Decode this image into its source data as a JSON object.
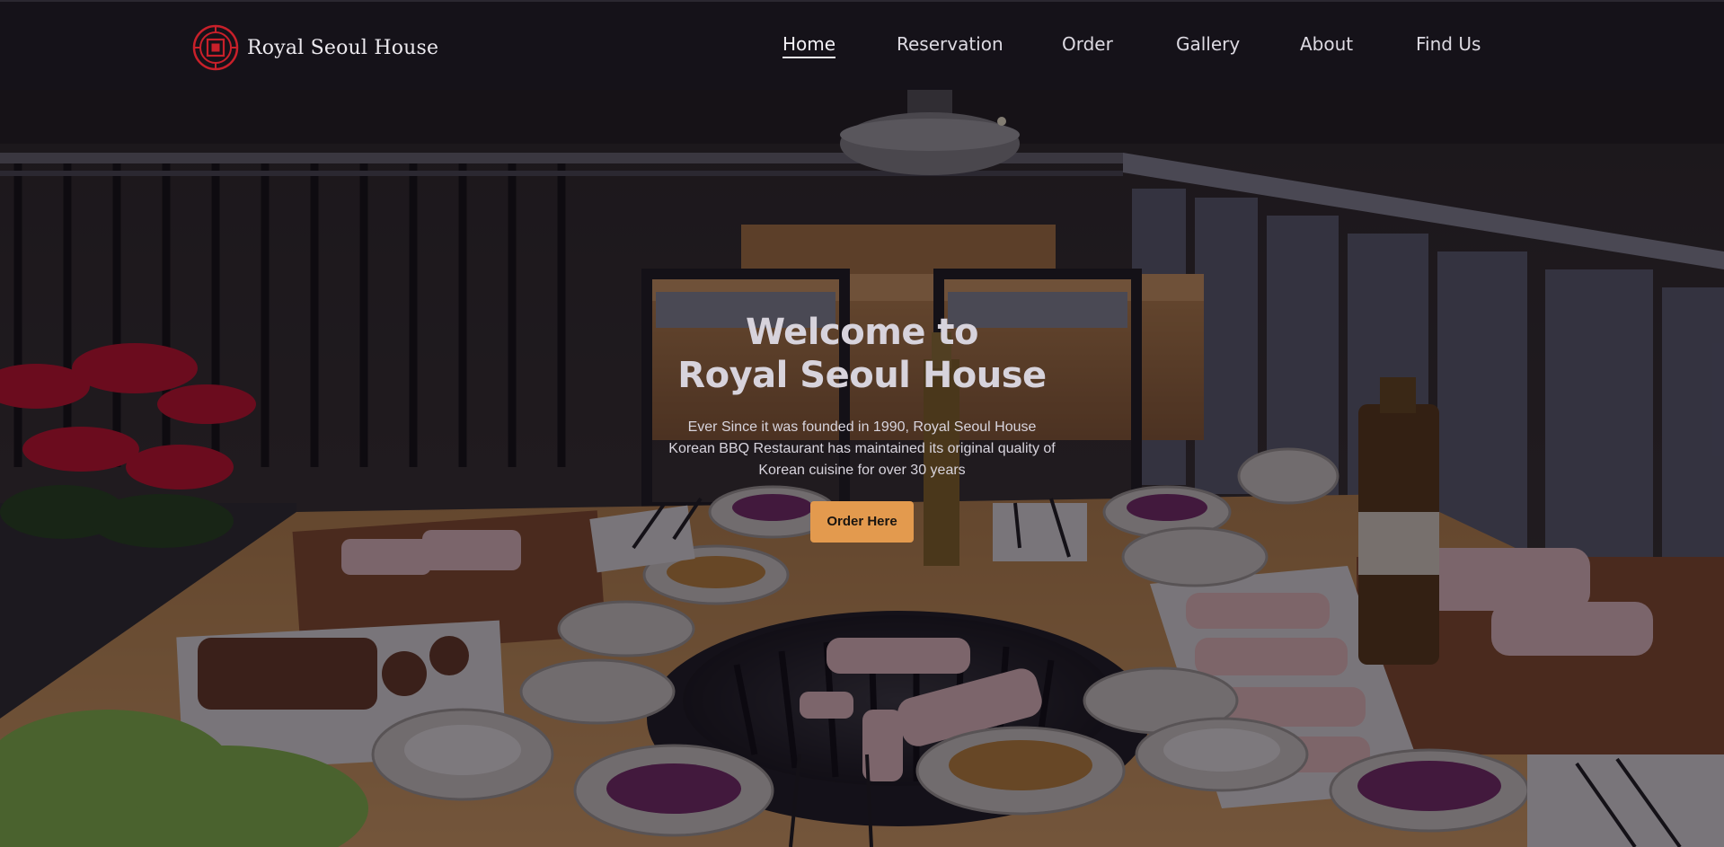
{
  "brand": {
    "name": "Royal Seoul House",
    "logo_icon": "royal-seal-icon",
    "accent_color": "#c8202a"
  },
  "nav": {
    "items": [
      {
        "label": "Home",
        "active": true
      },
      {
        "label": "Reservation",
        "active": false
      },
      {
        "label": "Order",
        "active": false
      },
      {
        "label": "Gallery",
        "active": false
      },
      {
        "label": "About",
        "active": false
      },
      {
        "label": "Find Us",
        "active": false
      }
    ]
  },
  "hero": {
    "title_line1": "Welcome to",
    "title_line2": "Royal Seoul House",
    "description": "Ever Since it was founded in 1990, Royal Seoul House Korean BBQ Restaurant has maintained its original quality of Korean cuisine for over 30 years",
    "cta_label": "Order Here",
    "cta_color": "#e39a4e"
  }
}
